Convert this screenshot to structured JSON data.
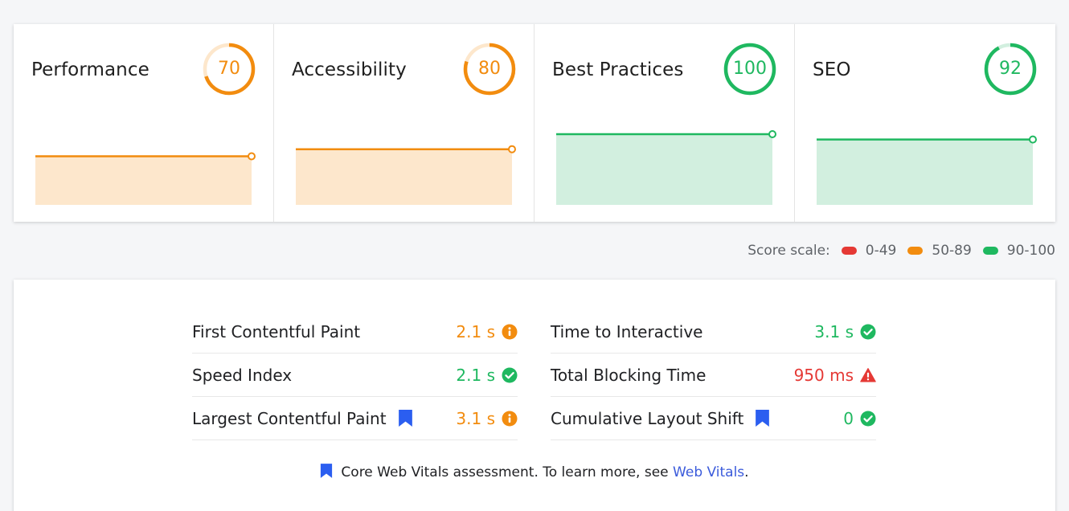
{
  "colors": {
    "fail": "#e53935",
    "average": "#f28c0f",
    "pass": "#1fb860",
    "average_fill": "#fde7cc",
    "pass_fill": "#d2efdf",
    "link": "#3b5bdb",
    "bookmark": "#2b5ef0"
  },
  "categories": [
    {
      "title": "Performance",
      "score": 70,
      "rating": "average",
      "trend_level": 0.55
    },
    {
      "title": "Accessibility",
      "score": 80,
      "rating": "average",
      "trend_level": 0.63
    },
    {
      "title": "Best Practices",
      "score": 100,
      "rating": "pass",
      "trend_level": 0.8
    },
    {
      "title": "SEO",
      "score": 92,
      "rating": "pass",
      "trend_level": 0.74
    }
  ],
  "score_scale": {
    "label": "Score scale:",
    "ranges": [
      {
        "label": "0-49",
        "rating": "fail"
      },
      {
        "label": "50-89",
        "rating": "average"
      },
      {
        "label": "90-100",
        "rating": "pass"
      }
    ]
  },
  "metrics": {
    "left": [
      {
        "name": "First Contentful Paint",
        "value": "2.1 s",
        "rating": "average",
        "core_web_vital": false
      },
      {
        "name": "Speed Index",
        "value": "2.1 s",
        "rating": "pass",
        "core_web_vital": false
      },
      {
        "name": "Largest Contentful Paint",
        "value": "3.1 s",
        "rating": "average",
        "core_web_vital": true
      }
    ],
    "right": [
      {
        "name": "Time to Interactive",
        "value": "3.1 s",
        "rating": "pass",
        "core_web_vital": false
      },
      {
        "name": "Total Blocking Time",
        "value": "950 ms",
        "rating": "fail",
        "core_web_vital": false
      },
      {
        "name": "Cumulative Layout Shift",
        "value": "0",
        "rating": "pass",
        "core_web_vital": true
      }
    ]
  },
  "footnote": {
    "text": "Core Web Vitals assessment. To learn more, see ",
    "link": "Web Vitals",
    "end": "."
  },
  "icons": {
    "average": "info-circle-icon",
    "pass": "check-circle-icon",
    "fail": "warning-triangle-icon",
    "core_web_vital": "bookmark-icon"
  }
}
